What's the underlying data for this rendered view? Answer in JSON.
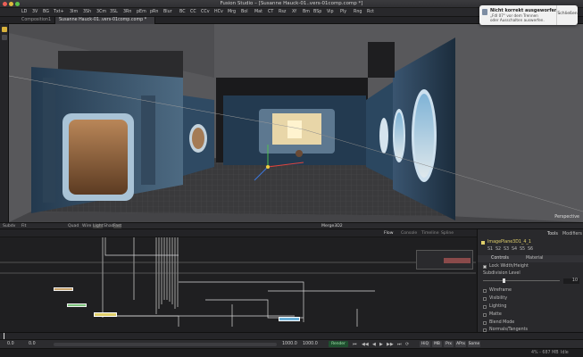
{
  "window": {
    "title": "Fusion Studio – [Susanne Hauck-01..vers-01comp.comp *]"
  },
  "toolbar": {
    "tools": [
      "LD",
      "3V",
      "BG",
      "Txt+",
      "3Im",
      "3Sh",
      "3Cm",
      "3SL",
      "3Rn",
      "pEm",
      "pRn",
      "Blur",
      "BC",
      "CC",
      "CCv",
      "HCv",
      "Mrg",
      "Bol",
      "Mat",
      "CT",
      "Rsz",
      "Xf",
      "Bm",
      "BSp",
      "Vip",
      "Ply",
      "Rng",
      "Rct"
    ]
  },
  "notification": {
    "title": "Nicht korrekt ausgeworfen",
    "body": "„Fdl 07“ vor dem Trennen oder Ausschalten auswerfen.",
    "button": "Schließen"
  },
  "tabs": [
    "Composition1",
    "Susanne Hauck-01..vers-01comp.comp *"
  ],
  "viewer": {
    "label_right": "Perspective"
  },
  "viewbar": {
    "left": [
      "Subdv",
      "Fit",
      "Quad"
    ],
    "modes": [
      "Wire",
      "Light",
      "Shad",
      "Fast"
    ],
    "node": "Merge3D2"
  },
  "flow": {
    "tabs": [
      "Flow",
      "Console",
      "Timeline",
      "Spline"
    ],
    "nodes": [
      {
        "name": "ImagePlane3D1"
      },
      {
        "name": "Merge3D2"
      },
      {
        "name": "Camera3D1"
      },
      {
        "name": "ImagePlane3D1_4"
      }
    ]
  },
  "inspector": {
    "tabs": [
      "Tools",
      "Modifiers"
    ],
    "node": "ImagePlane3D1_4_1",
    "subtabs": [
      "S1",
      "S2",
      "S3",
      "S4",
      "S5",
      "S6"
    ],
    "section_tabs": [
      "Controls",
      "Material"
    ],
    "lock_label": "Lock Width/Height",
    "subdivision_label": "Subdivision Level",
    "subdivision_value": "10",
    "options": [
      "Wireframe",
      "Visibility",
      "Lighting",
      "Matte",
      "Blend Mode",
      "Normals/Tangents",
      "Object ID"
    ]
  },
  "transport": {
    "start": "0.0",
    "current": "0.0",
    "end_a": "1000.0",
    "end_b": "1000.0",
    "render": "Render",
    "right_buttons": [
      "HiQ",
      "MB",
      "Prx",
      "APrx",
      "Some"
    ]
  },
  "status": {
    "memory": "4% - 687 MB",
    "state": "Idle"
  }
}
